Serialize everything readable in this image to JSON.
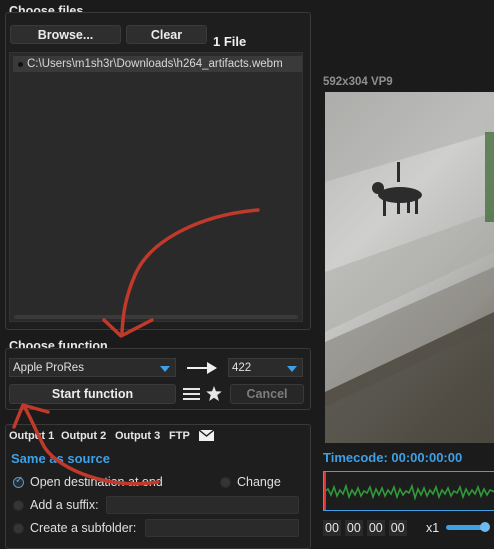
{
  "choose_files": {
    "title": "Choose files",
    "browse_label": "Browse...",
    "clear_label": "Clear",
    "file_count": "1 File",
    "files": [
      "C:\\Users\\m1sh3r\\Downloads\\h264_artifacts.webm"
    ]
  },
  "preview": {
    "info": "592x304 VP9"
  },
  "choose_function": {
    "title": "Choose function",
    "codec": "Apple ProRes",
    "profile": "422",
    "start_label": "Start function",
    "cancel_label": "Cancel"
  },
  "output": {
    "tabs": [
      "Output 1",
      "Output 2",
      "Output 3",
      "FTP"
    ],
    "same_as_source": "Same as source",
    "open_destination": "Open destination at end",
    "change": "Change",
    "add_suffix": "Add a suffix:",
    "create_subfolder": "Create a subfolder:"
  },
  "timeline": {
    "timecode_label": "Timecode: 00:00:00:00",
    "tc_fields": [
      "00",
      "00",
      "00",
      "00"
    ],
    "speed": "x1"
  },
  "colors": {
    "accent": "#3ea0e6",
    "waveform": "#2f9a3a",
    "annotation": "#c0392b"
  },
  "icons": [
    "list-icon",
    "star-icon",
    "mail-icon",
    "arrow-right-icon"
  ]
}
